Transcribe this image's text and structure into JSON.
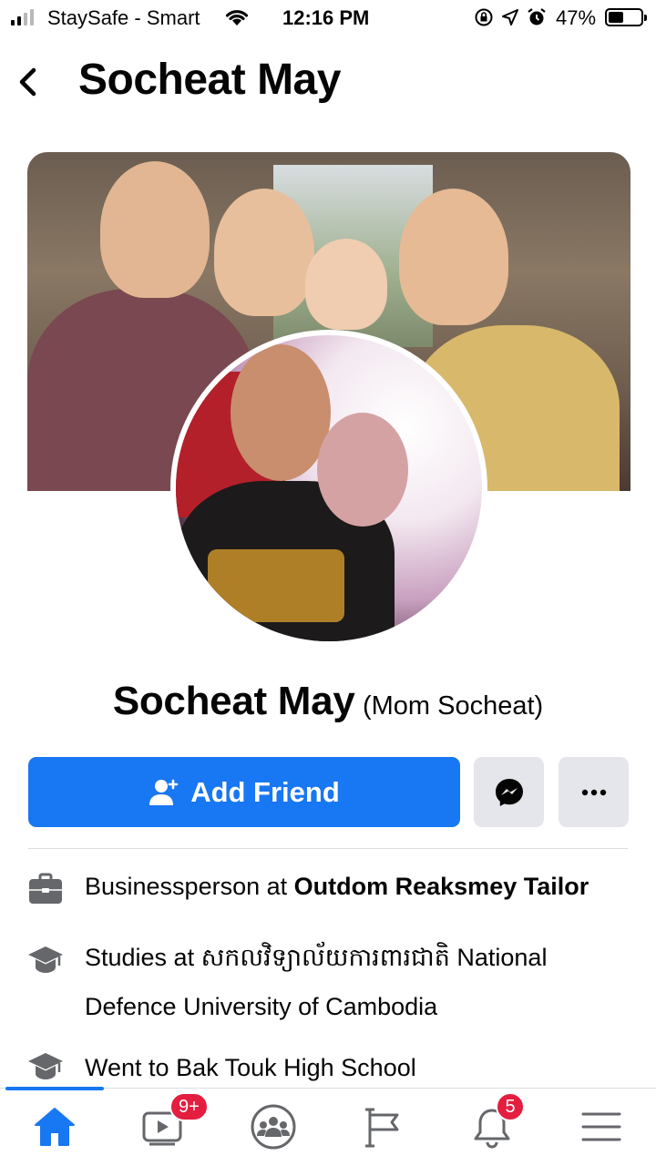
{
  "status_bar": {
    "carrier": "StaySafe - Smart",
    "time": "12:16 PM",
    "battery_percent": "47%",
    "battery_level": 0.47,
    "icons": [
      "signal-icon",
      "wifi-icon",
      "screen-lock-icon",
      "location-icon",
      "alarm-icon",
      "battery-icon"
    ]
  },
  "header": {
    "title": "Socheat May",
    "back_icon": "chevron-left-icon"
  },
  "profile": {
    "name": "Socheat May",
    "alternate_name": "(Mom Socheat)"
  },
  "actions": {
    "add_friend_label": "Add Friend",
    "add_friend_icon": "add-friend-icon",
    "messenger_icon": "messenger-icon",
    "more_icon": "more-icon"
  },
  "details": [
    {
      "icon": "briefcase-icon",
      "prefix": "Businessperson at ",
      "bold": "Outdom Reaksmey Tailor"
    },
    {
      "icon": "graduation-cap-icon",
      "prefix": "Studies at ",
      "text": "សកលវិទ្យាល័យការពារជាតិ National Defence University of Cambodia"
    },
    {
      "icon": "graduation-cap-icon",
      "prefix": "Went to ",
      "text": "Bak Touk High School"
    }
  ],
  "bottom_nav": {
    "items": [
      {
        "name": "home",
        "icon": "home-icon",
        "active": true
      },
      {
        "name": "watch",
        "icon": "video-icon",
        "badge": "9+"
      },
      {
        "name": "groups",
        "icon": "groups-icon"
      },
      {
        "name": "pages",
        "icon": "flag-icon"
      },
      {
        "name": "notifications",
        "icon": "bell-icon",
        "badge": "5"
      },
      {
        "name": "menu",
        "icon": "menu-icon"
      }
    ]
  },
  "colors": {
    "accent": "#1877f2",
    "badge": "#e41e3f",
    "secondary_button": "#e4e6eb",
    "icon_gray": "#65676b"
  }
}
